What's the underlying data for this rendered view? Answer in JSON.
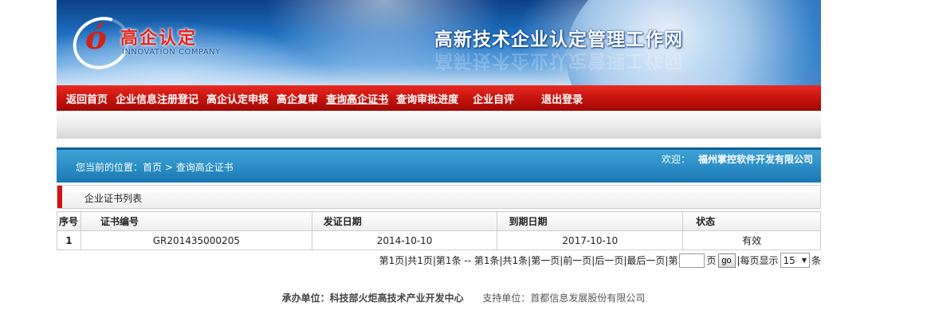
{
  "banner": {
    "logo_glyph": "ó",
    "logo_cn": "高企认定",
    "logo_en": "INNOVATION COMPANY",
    "site_title": "高新技术企业认定管理工作网"
  },
  "nav": {
    "items": [
      {
        "label": "返回首页"
      },
      {
        "label": "企业信息注册登记"
      },
      {
        "label": "高企认定申报"
      },
      {
        "label": "高企复审"
      },
      {
        "label": "查询高企证书"
      },
      {
        "label": "查询审批进度"
      },
      {
        "label": "企业自评"
      },
      {
        "label": "退出登录"
      }
    ],
    "active_index": 4,
    "color": "#c4120c"
  },
  "location": {
    "prefix": "您当前的位置：",
    "home": "首页",
    "separator": ">",
    "current": "查询高企证书",
    "welcome": "欢迎：",
    "company": "福州掌控软件开发有限公司"
  },
  "section": {
    "title": "企业证书列表"
  },
  "table": {
    "headers": [
      "序号",
      "证书编号",
      "发证日期",
      "到期日期",
      "状态"
    ],
    "rows": [
      [
        "1",
        "GR201435000205",
        "2014-10-10",
        "2017-10-10",
        "有效"
      ]
    ]
  },
  "pager": {
    "summary": "第1页|共1页|第1条 -- 第1条|共1条|",
    "first": "第一页",
    "prev": "前一页",
    "next": "后一页",
    "last": "最后一页",
    "sep": "|",
    "goto_prefix": "第",
    "goto_suffix": "页",
    "go_label": "go",
    "page_input_value": "",
    "per_page_prefix": "|每页显示",
    "per_page_value": "15",
    "per_page_suffix": "条"
  },
  "footer": {
    "host_label": "承办单位：",
    "host": "科技部火炬高技术产业开发中心",
    "support_label": "支持单位：",
    "support": "首都信息发展股份有限公司"
  }
}
